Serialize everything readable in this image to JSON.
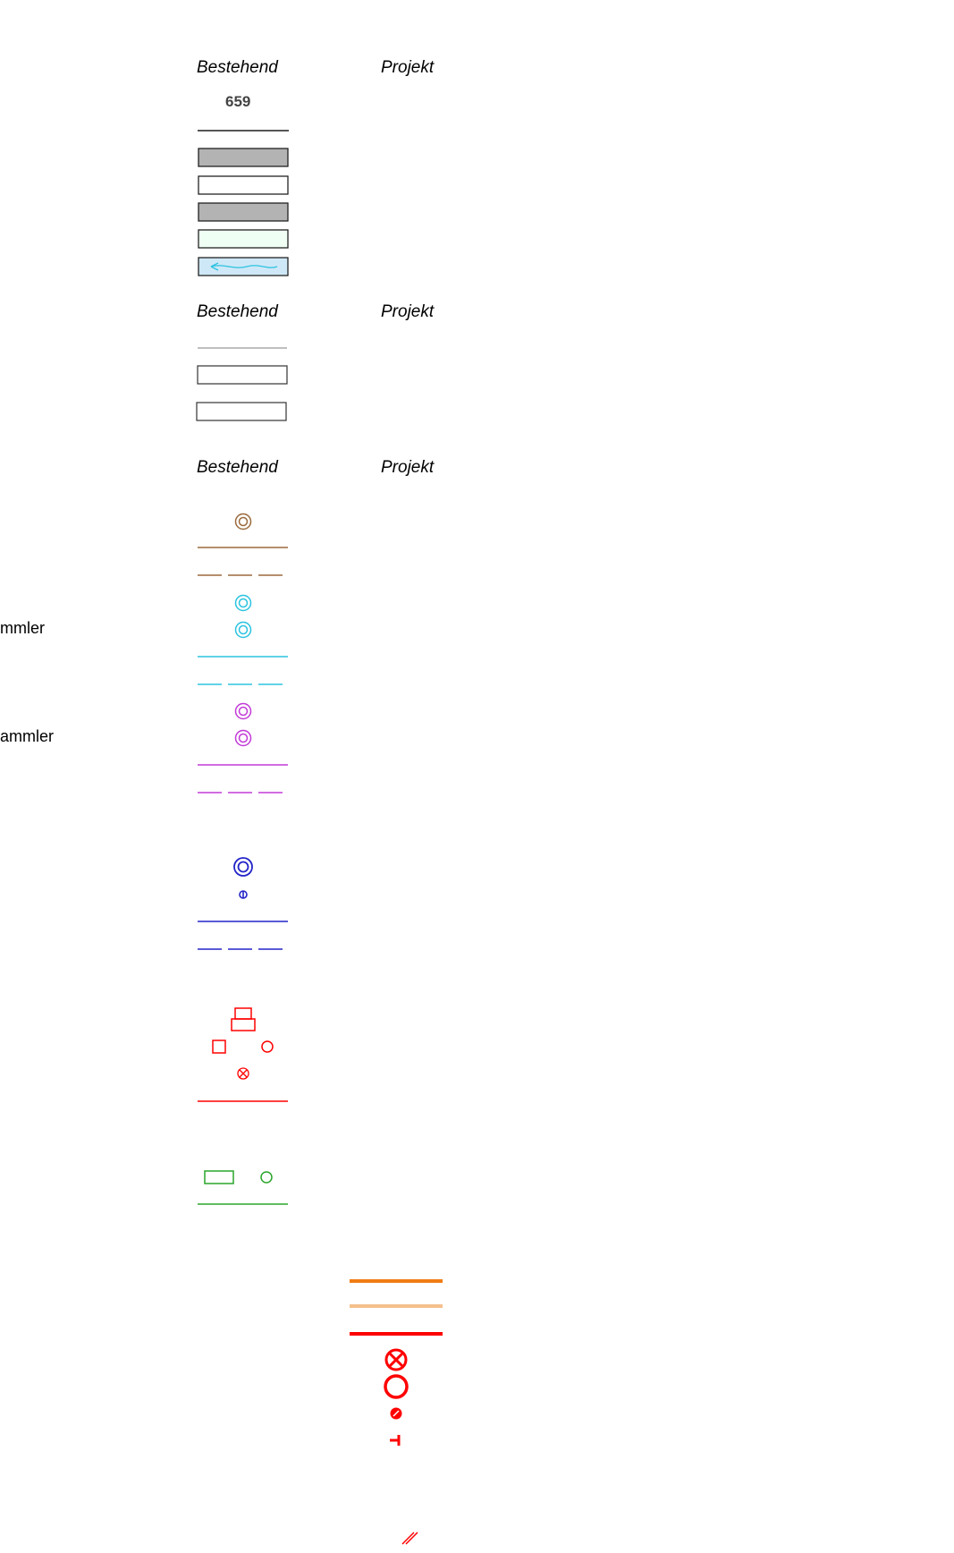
{
  "legend": {
    "section_1": {
      "col_existing": "Bestehend",
      "col_project": "Projekt",
      "parcel_number": "659"
    },
    "section_2": {
      "col_existing": "Bestehend",
      "col_project": "Projekt"
    },
    "section_3": {
      "col_existing": "Bestehend",
      "col_project": "Projekt"
    },
    "row_labels": {
      "clean_water_collector": "mmler",
      "waste_water_collector": "ammler"
    }
  },
  "colors": {
    "brown": "#9b6a3c",
    "cyan": "#2bc3e0",
    "magenta": "#c33ad8",
    "blue": "#2323c8",
    "red": "#ff0000",
    "green": "#2aa52a",
    "orange": "#f07d14",
    "light_orange": "#f5c08c",
    "grey_fill": "#b3b3b3",
    "mint_fill": "#f0fff4",
    "water_fill": "#cfe8f7"
  }
}
